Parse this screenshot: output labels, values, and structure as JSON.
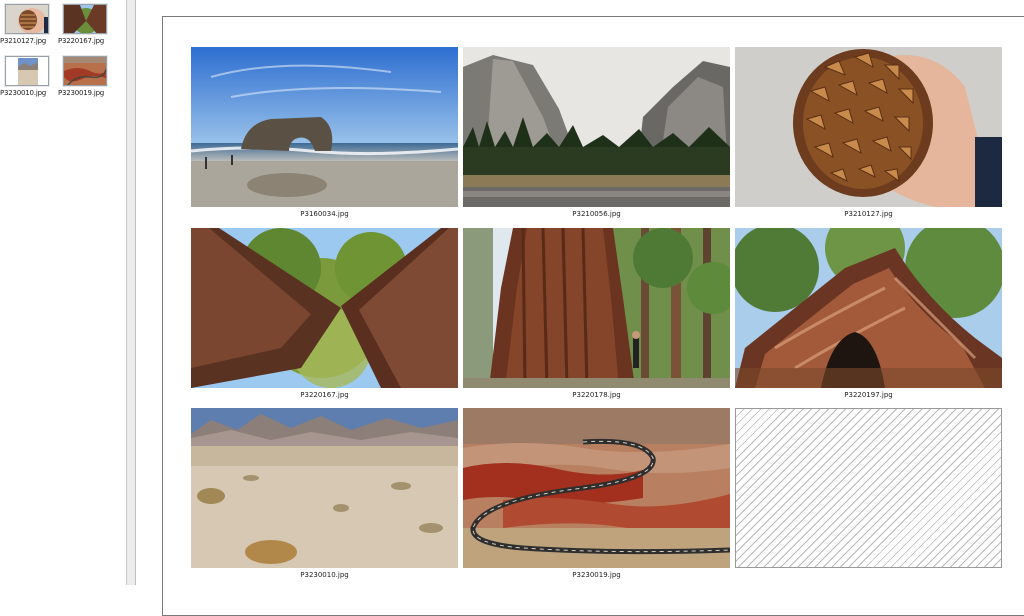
{
  "thumbnails": [
    {
      "filename": "P3210127.jpg",
      "subject": "pinecone-in-hand"
    },
    {
      "filename": "P3220167.jpg",
      "subject": "two-sequoias-looking-up"
    },
    {
      "filename": "P3230010.jpg",
      "subject": "desert-mountains"
    },
    {
      "filename": "P3230019.jpg",
      "subject": "red-canyon-road"
    }
  ],
  "photos": [
    {
      "filename": "P3160034.jpg",
      "subject": "sea-arch-beach"
    },
    {
      "filename": "P3210056.jpg",
      "subject": "yosemite-valley"
    },
    {
      "filename": "P3210127.jpg",
      "subject": "pinecone-in-hand"
    },
    {
      "filename": "P3220167.jpg",
      "subject": "two-sequoias-looking-up"
    },
    {
      "filename": "P3220178.jpg",
      "subject": "giant-sequoia-with-person"
    },
    {
      "filename": "P3220197.jpg",
      "subject": "sequoia-base-with-hollow"
    },
    {
      "filename": "P3230010.jpg",
      "subject": "desert-mountains"
    },
    {
      "filename": "P3230019.jpg",
      "subject": "red-canyon-road"
    }
  ],
  "empty_slot": {
    "pattern": "diagonal-hatch"
  }
}
